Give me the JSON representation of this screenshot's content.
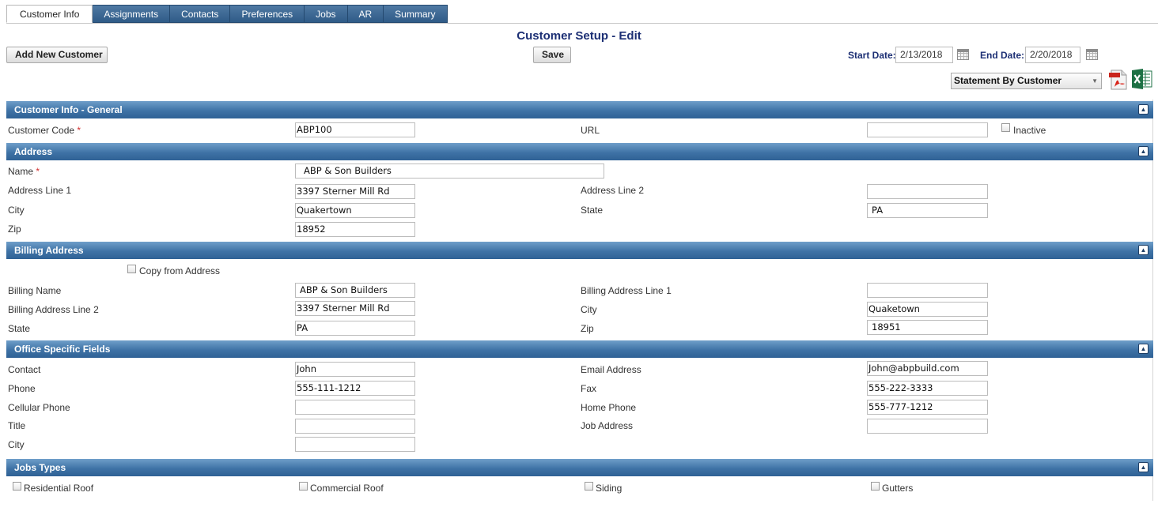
{
  "tabs": [
    "Customer Info",
    "Assignments",
    "Contacts",
    "Preferences",
    "Jobs",
    "AR",
    "Summary"
  ],
  "page_title": "Customer Setup - Edit",
  "buttons": {
    "add_new_customer": "Add New Customer",
    "save": "Save"
  },
  "dates": {
    "start_label": "Start Date:",
    "start_value": "2/13/2018",
    "end_label": "End Date:",
    "end_value": "2/20/2018"
  },
  "report_select": {
    "selected": "Statement By Customer"
  },
  "sections": {
    "general": {
      "title": "Customer Info - General",
      "customer_code_label": "Customer Code",
      "customer_code_value": "ABP100",
      "url_label": "URL",
      "url_value": "",
      "inactive_label": "Inactive"
    },
    "address": {
      "title": "Address",
      "name_label": "Name",
      "name_value": "ABP & Son Builders",
      "line1_label": "Address Line 1",
      "line1_value": "3397 Sterner Mill Rd",
      "line2_label": "Address Line 2",
      "line2_value": "",
      "city_label": "City",
      "city_value": "Quakertown",
      "state_label": "State",
      "state_value": "PA",
      "zip_label": "Zip",
      "zip_value": "18952"
    },
    "billing": {
      "title": "Billing Address",
      "copy_label": "Copy from Address",
      "name_label": "Billing Name",
      "name_value": "ABP & Son Builders",
      "line1_label": "Billing Address Line 1",
      "line1_value": "",
      "line2_label": "Billing Address Line 2",
      "line2_value": "3397 Sterner Mill Rd",
      "city_label": "City",
      "city_value": "Quaketown",
      "state_label": "State",
      "state_value": "PA",
      "zip_label": "Zip",
      "zip_value": "18951"
    },
    "office": {
      "title": "Office Specific Fields",
      "contact_label": "Contact",
      "contact_value": "John",
      "email_label": "Email Address",
      "email_value": "John@abpbuild.com",
      "phone_label": "Phone",
      "phone_value": "555-111-1212",
      "fax_label": "Fax",
      "fax_value": "555-222-3333",
      "cell_label": "Cellular Phone",
      "cell_value": "",
      "home_label": "Home Phone",
      "home_value": "555-777-1212",
      "title_label": "Title",
      "title_value": "",
      "job_address_label": "Job Address",
      "job_address_value": "",
      "city_label": "City",
      "city_value": ""
    },
    "jobs_types": {
      "title": "Jobs Types",
      "items": [
        "Residential Roof",
        "Commercial Roof",
        "Siding",
        "Gutters"
      ]
    }
  },
  "colors": {
    "header_blue": "#3f73a6",
    "title_navy": "#1c2f74",
    "required_red": "#d23030"
  }
}
